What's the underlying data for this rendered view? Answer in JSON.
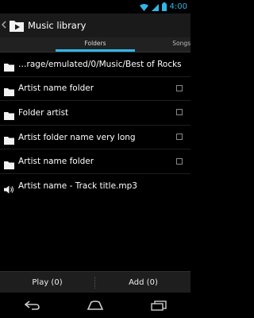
{
  "status_bar": {
    "time": "4:00",
    "icons": [
      "wifi-icon",
      "signal-icon",
      "battery-icon"
    ],
    "accent_color": "#33b5e5"
  },
  "action_bar": {
    "title": "Music library",
    "up_icon": "up-caret-icon",
    "app_icon": "music-folder-icon"
  },
  "tabs": [
    {
      "label": "Folders",
      "selected": true
    },
    {
      "label": "Songs",
      "selected": false
    }
  ],
  "list": [
    {
      "label": "…rage/emulated/0/Music/Best of Rocks",
      "icon": "folder-icon",
      "checkbox": false
    },
    {
      "label": "Artist name folder",
      "icon": "folder-icon",
      "checkbox": true
    },
    {
      "label": "Folder artist",
      "icon": "folder-icon",
      "checkbox": true
    },
    {
      "label": "Artist folder name very long",
      "icon": "folder-icon",
      "checkbox": true
    },
    {
      "label": "Artist name folder",
      "icon": "folder-icon",
      "checkbox": true
    },
    {
      "label": "Artist name - Track title.mp3",
      "icon": "speaker-icon",
      "checkbox": false
    }
  ],
  "bottom_bar": {
    "play_label": "Play (0)",
    "add_label": "Add (0)"
  },
  "nav_bar": {
    "icons": [
      "back-icon",
      "home-icon",
      "recent-apps-icon"
    ]
  }
}
